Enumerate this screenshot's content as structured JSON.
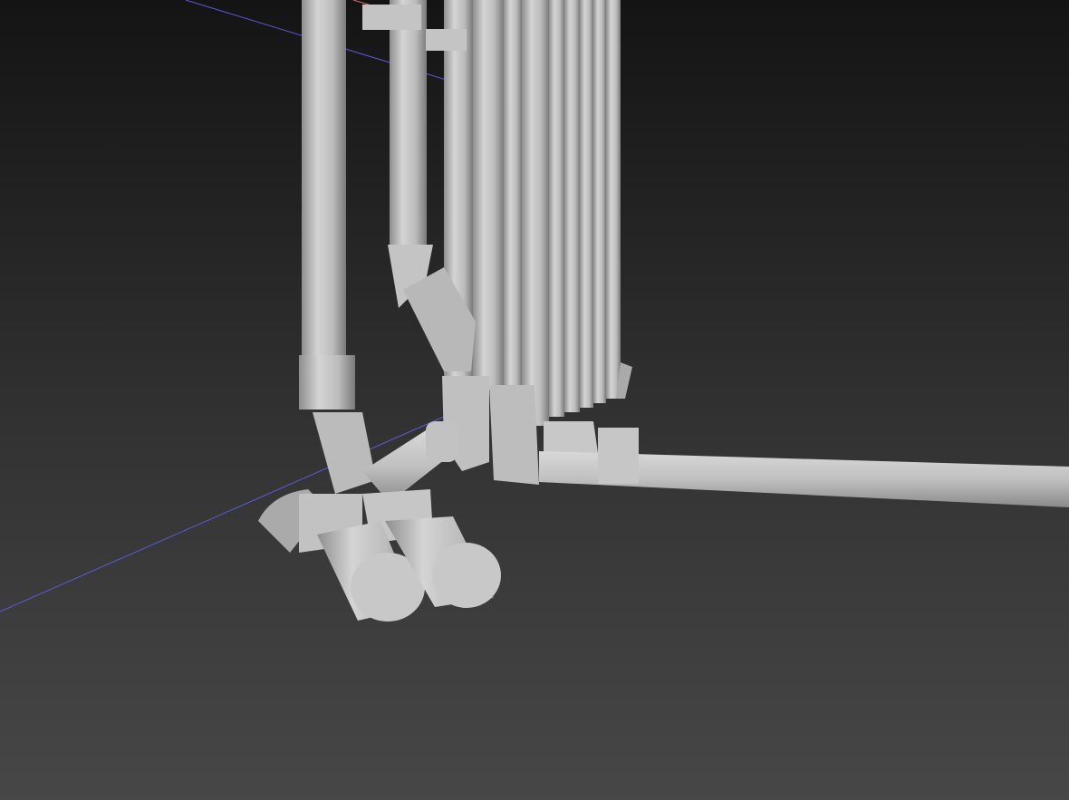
{
  "viewport": {
    "background_top": "#141414",
    "background_bottom": "#454545",
    "pipe_color": "#bdbdbd",
    "axis_x_color": "#5a5ad8",
    "axis_y_color": "#d87070"
  }
}
